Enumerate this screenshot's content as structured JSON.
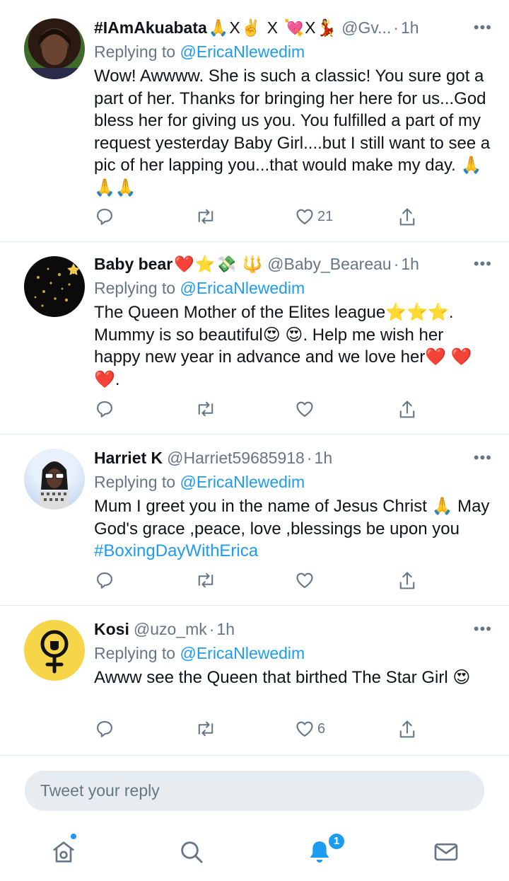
{
  "tweets": [
    {
      "name": "#IAmAkuabata",
      "emojis": "🙏X✌️ X 💘X💃",
      "handle": "@Gv...",
      "time": "1h",
      "replying_prefix": "Replying to",
      "replying_to": "@EricaNlewedim",
      "text": "Wow! Awwww. She is such a classic! You sure got a part of her. Thanks for bringing her here for us...God bless her for giving us you.  You fulfilled a part of my request yesterday Baby Girl....but I still want to see a pic of her lapping you...that would make my day. 🙏🙏🙏",
      "hashtag": "",
      "likes": "21"
    },
    {
      "name": "Baby bear",
      "emojis": "❤️⭐💸 🔱",
      "handle": "@Baby_Beareau",
      "time": "1h",
      "replying_prefix": "Replying to",
      "replying_to": "@EricaNlewedim",
      "text": "The Queen Mother of the Elites league⭐⭐⭐. Mummy is so beautiful😍 😍. Help me wish her happy new year in advance and we love her❤️ ❤️ ❤️.",
      "hashtag": "",
      "likes": ""
    },
    {
      "name": "Harriet K",
      "emojis": "",
      "handle": "@Harriet59685918",
      "time": "1h",
      "replying_prefix": "Replying to",
      "replying_to": "@EricaNlewedim",
      "text": "Mum I greet you in the name of Jesus Christ 🙏 May God's grace ,peace, love ,blessings be upon you ",
      "hashtag": "#BoxingDayWithErica",
      "likes": ""
    },
    {
      "name": "Kosi",
      "emojis": "",
      "handle": "@uzo_mk",
      "time": "1h",
      "replying_prefix": "Replying to",
      "replying_to": "@EricaNlewedim",
      "text": "Awww see the Queen that birthed The Star Girl 😍",
      "hashtag": "",
      "likes": "6"
    }
  ],
  "more_glyph": "•••",
  "dot_glyph": "·",
  "composer": {
    "placeholder": "Tweet your reply"
  },
  "tabbar": {
    "notifications_badge": "1"
  },
  "colors": {
    "accent": "#1d9bf0",
    "secondary_text": "#657786",
    "divider": "#e1e8ed",
    "composer_bg": "#e6ecf0"
  },
  "icons": {
    "reply": "reply-icon",
    "retweet": "retweet-icon",
    "like": "like-icon",
    "share": "share-icon",
    "home": "home-icon",
    "search": "search-icon",
    "notifications": "bell-icon",
    "messages": "mail-icon"
  }
}
